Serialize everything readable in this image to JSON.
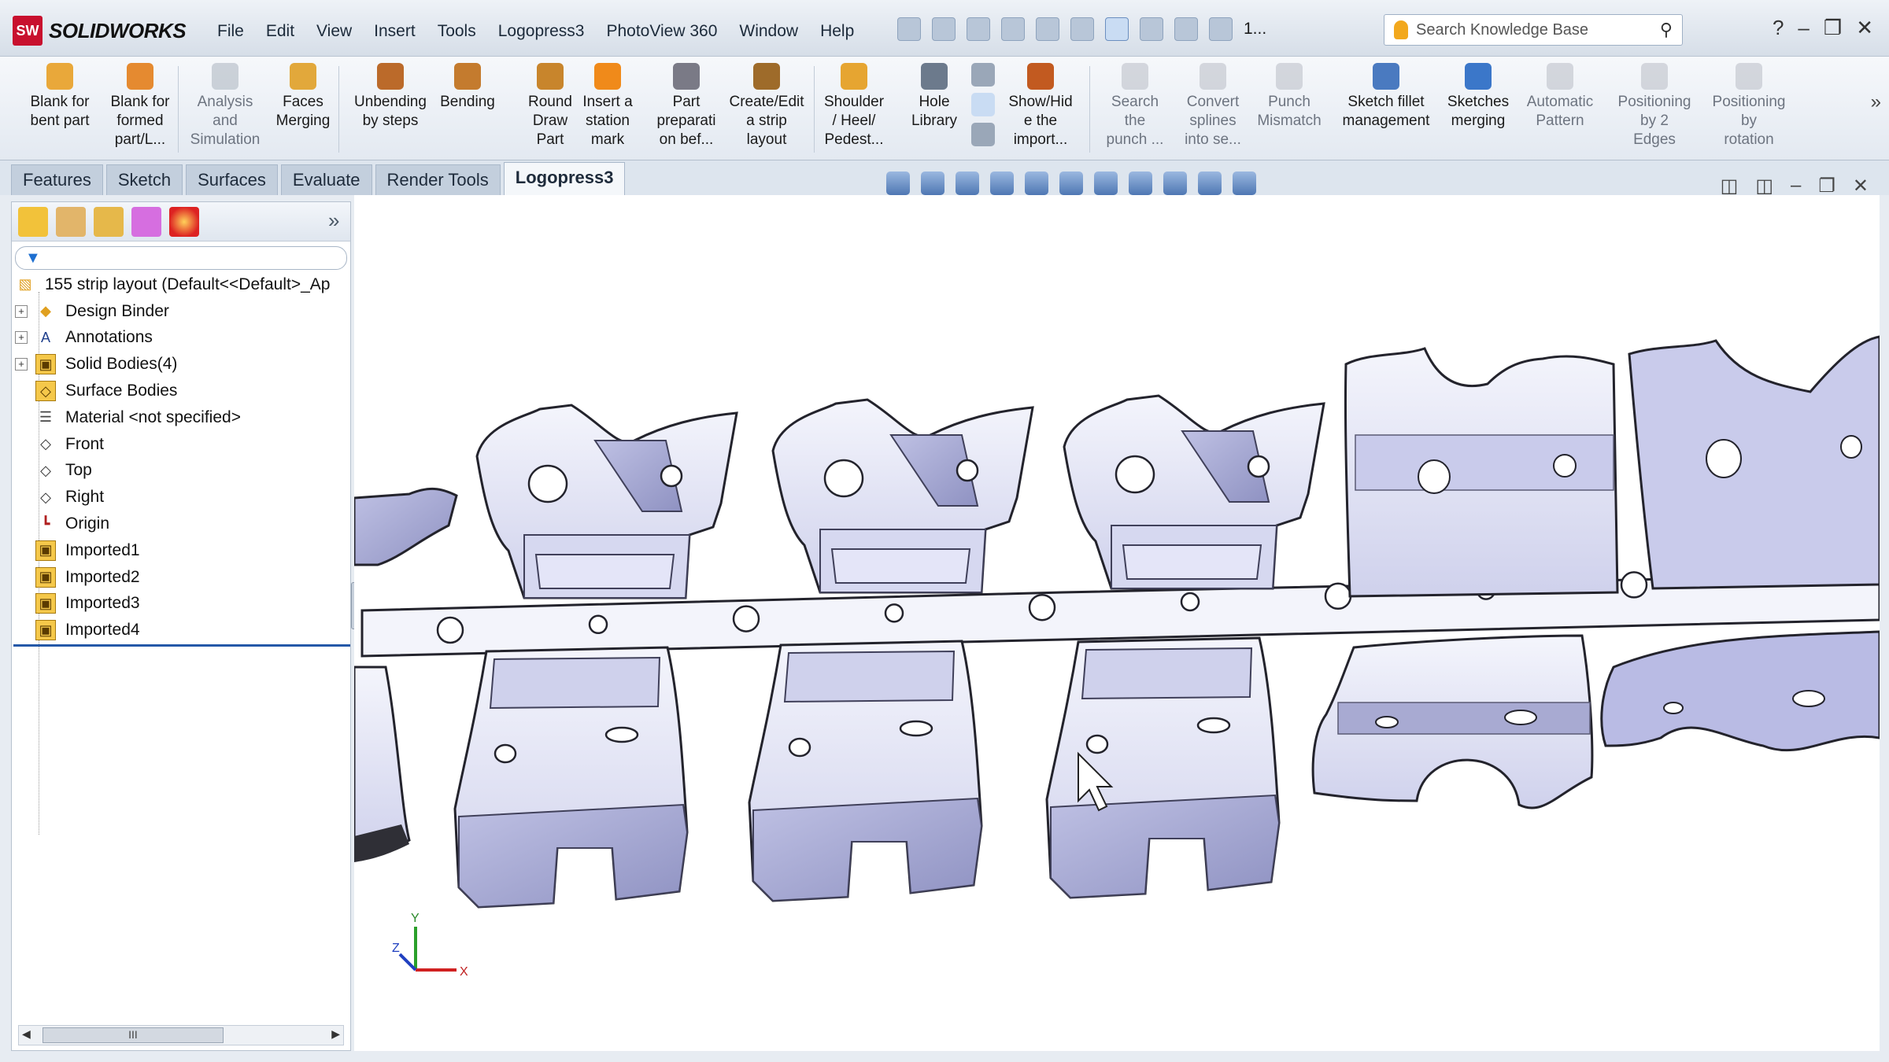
{
  "app": {
    "brand": "SOLIDWORKS",
    "logo_text": "SW"
  },
  "menu": [
    "File",
    "Edit",
    "View",
    "Insert",
    "Tools",
    "Logopress3",
    "PhotoView 360",
    "Window",
    "Help"
  ],
  "quick_access_more": "1...",
  "search": {
    "placeholder": "Search Knowledge Base"
  },
  "toolbar": [
    {
      "label": "Blank for\nbent part",
      "icon": "blank-bent-icon",
      "enabled": true
    },
    {
      "label": "Blank for\nformed\npart/L...",
      "icon": "blank-formed-icon",
      "enabled": true
    },
    {
      "label": "Analysis\nand\nSimulation",
      "icon": "analysis-icon",
      "enabled": false
    },
    {
      "label": "Faces\nMerging",
      "icon": "faces-merge-icon",
      "enabled": true
    },
    {
      "label": "Unbending\nby steps",
      "icon": "unbend-icon",
      "enabled": true
    },
    {
      "label": "Bending",
      "icon": "bending-icon",
      "enabled": true
    },
    {
      "label": "Round\nDraw\nPart",
      "icon": "round-draw-icon",
      "enabled": true
    },
    {
      "label": "Insert a\nstation\nmark",
      "icon": "station-mark-icon",
      "enabled": true
    },
    {
      "label": "Part\npreparati\non bef...",
      "icon": "part-prep-icon",
      "enabled": true
    },
    {
      "label": "Create/Edit\na strip\nlayout",
      "icon": "strip-layout-icon",
      "enabled": true
    },
    {
      "label": "Shoulder\n/ Heel/\nPedest...",
      "icon": "shoulder-icon",
      "enabled": true
    },
    {
      "label": "Hole\nLibrary",
      "icon": "hole-library-icon",
      "enabled": true
    },
    {
      "label": "Show/Hid\ne the\nimport...",
      "icon": "show-hide-icon",
      "enabled": true
    },
    {
      "label": "Search\nthe\npunch ...",
      "icon": "search-punch-icon",
      "enabled": false
    },
    {
      "label": "Convert\nsplines\ninto se...",
      "icon": "convert-splines-icon",
      "enabled": false
    },
    {
      "label": "Punch\nMismatch",
      "icon": "punch-mismatch-icon",
      "enabled": false
    },
    {
      "label": "Sketch fillet\nmanagement",
      "icon": "sketch-fillet-icon",
      "enabled": true
    },
    {
      "label": "Sketches\nmerging",
      "icon": "sketches-merge-icon",
      "enabled": true
    },
    {
      "label": "Automatic\nPattern",
      "icon": "auto-pattern-icon",
      "enabled": false
    },
    {
      "label": "Positioning\nby 2\nEdges",
      "icon": "position-2edges-icon",
      "enabled": false
    },
    {
      "label": "Positioning\nby\nrotation",
      "icon": "position-rotation-icon",
      "enabled": false
    }
  ],
  "tabs": [
    "Features",
    "Sketch",
    "Surfaces",
    "Evaluate",
    "Render Tools",
    "Logopress3"
  ],
  "active_tab": "Logopress3",
  "tree": {
    "root": "155 strip layout  (Default<<Default>_Ap",
    "items": [
      {
        "label": "Design Binder",
        "expandable": true,
        "icon": "design-binder-icon"
      },
      {
        "label": "Annotations",
        "expandable": true,
        "icon": "annotations-icon"
      },
      {
        "label": "Solid Bodies(4)",
        "expandable": true,
        "icon": "solid-bodies-icon"
      },
      {
        "label": "Surface Bodies",
        "expandable": false,
        "icon": "surface-bodies-icon"
      },
      {
        "label": "Material <not specified>",
        "expandable": false,
        "icon": "material-icon"
      },
      {
        "label": "Front",
        "expandable": false,
        "icon": "plane-icon"
      },
      {
        "label": "Top",
        "expandable": false,
        "icon": "plane-icon"
      },
      {
        "label": "Right",
        "expandable": false,
        "icon": "plane-icon"
      },
      {
        "label": "Origin",
        "expandable": false,
        "icon": "origin-icon"
      },
      {
        "label": "Imported1",
        "expandable": false,
        "icon": "imported-body-icon"
      },
      {
        "label": "Imported2",
        "expandable": false,
        "icon": "imported-body-icon"
      },
      {
        "label": "Imported3",
        "expandable": false,
        "icon": "imported-body-icon"
      },
      {
        "label": "Imported4",
        "expandable": false,
        "icon": "imported-body-icon"
      }
    ]
  },
  "scrollbar_thumb": "III",
  "triad": {
    "x": "X",
    "y": "Y",
    "z": "Z"
  },
  "colors": {
    "accent": "#2458a8",
    "brand_red": "#c8102e",
    "part_fill": "#e3e5f6",
    "part_shade": "#a8aad2",
    "part_edge": "#2b2b35"
  }
}
